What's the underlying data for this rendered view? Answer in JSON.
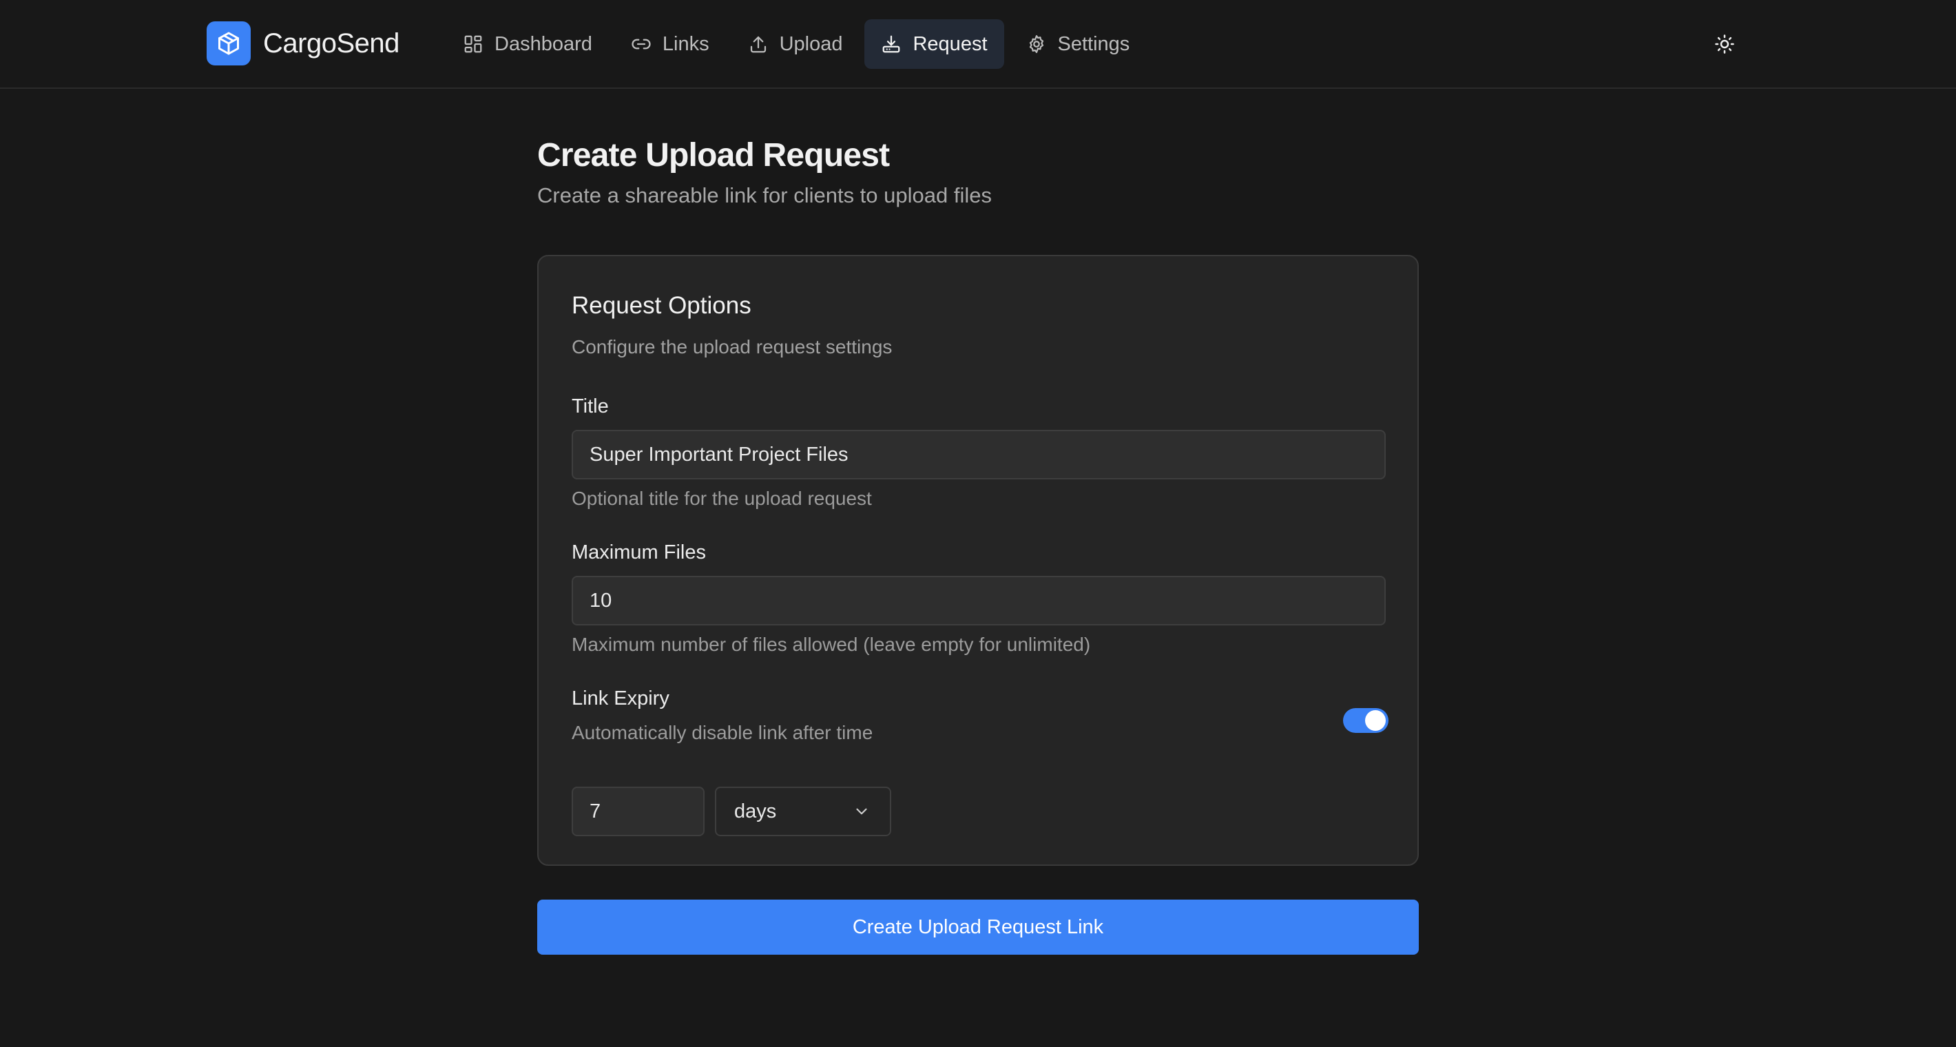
{
  "app": {
    "name": "CargoSend"
  },
  "nav": {
    "items": [
      {
        "label": "Dashboard",
        "icon": "dashboard-icon"
      },
      {
        "label": "Links",
        "icon": "link-icon"
      },
      {
        "label": "Upload",
        "icon": "upload-icon"
      },
      {
        "label": "Request",
        "icon": "download-tray-icon",
        "active": true
      },
      {
        "label": "Settings",
        "icon": "gear-icon"
      }
    ],
    "theme_toggle_icon": "sun-icon"
  },
  "page": {
    "title": "Create Upload Request",
    "subtitle": "Create a shareable link for clients to upload files"
  },
  "card": {
    "title": "Request Options",
    "description": "Configure the upload request settings",
    "title_field": {
      "label": "Title",
      "value": "Super Important Project Files",
      "help": "Optional title for the upload request"
    },
    "max_files_field": {
      "label": "Maximum Files",
      "value": "10",
      "help": "Maximum number of files allowed (leave empty for unlimited)"
    },
    "expiry": {
      "label": "Link Expiry",
      "help": "Automatically disable link after time",
      "enabled": true,
      "amount": "7",
      "unit": "days"
    }
  },
  "submit_label": "Create Upload Request Link",
  "colors": {
    "accent": "#3b82f6",
    "background": "#181818",
    "card": "#252525"
  }
}
